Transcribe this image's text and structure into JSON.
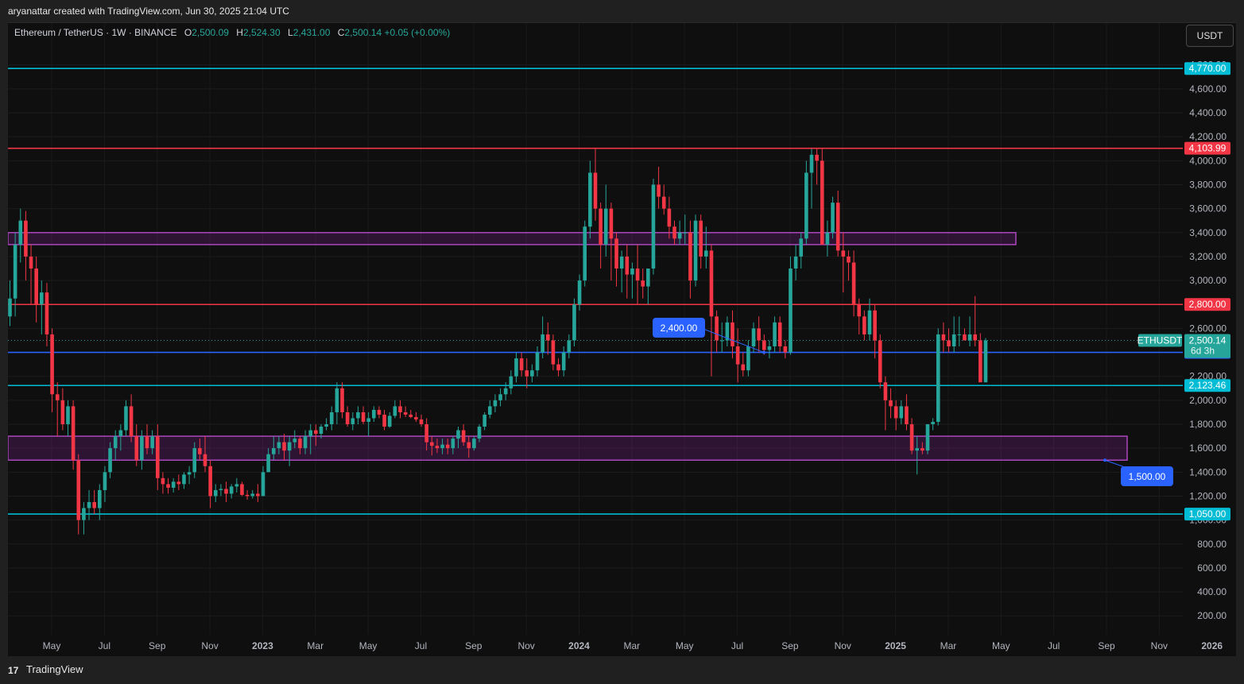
{
  "header": {
    "attribution": "aryanattar created with TradingView.com, Jun 30, 2025 21:04 UTC"
  },
  "legend": {
    "symbol": "Ethereum / TetherUS · 1W · BINANCE",
    "o_label": "O",
    "o_value": "2,500.09",
    "h_label": "H",
    "h_value": "2,524.30",
    "l_label": "L",
    "l_value": "2,431.00",
    "c_label": "C",
    "c_value": "2,500.14",
    "change": "+0.05 (+0.00%)"
  },
  "currency_button": "USDT",
  "footer": {
    "brand": "TradingView",
    "logo": "17"
  },
  "colors": {
    "up": "#26a69a",
    "down": "#f23645",
    "cyan": "#00bcd4",
    "red_line": "#f23645",
    "blue_line": "#2962ff",
    "zone": "#9c27b0",
    "background": "#0f0f0f"
  },
  "chart_data": {
    "type": "candlestick",
    "symbol": "ETHUSDT",
    "interval": "1W",
    "ylim": [
      100,
      4900
    ],
    "y_ticks": [
      "200.00",
      "400.00",
      "600.00",
      "800.00",
      "1,000.00",
      "1,200.00",
      "1,400.00",
      "1,600.00",
      "1,800.00",
      "2,000.00",
      "2,200.00",
      "2,400.00",
      "2,600.00",
      "2,800.00",
      "3,000.00",
      "3,200.00",
      "3,400.00",
      "3,600.00",
      "3,800.00",
      "4,000.00",
      "4,200.00",
      "4,400.00",
      "4,600.00",
      "4,800.00"
    ],
    "x_ticks": [
      "May",
      "Jul",
      "Sep",
      "Nov",
      "2023",
      "Mar",
      "May",
      "Jul",
      "Sep",
      "Nov",
      "2024",
      "Mar",
      "May",
      "Jul",
      "Sep",
      "Nov",
      "2025",
      "Mar",
      "May",
      "Jul",
      "Sep",
      "Nov",
      "2026"
    ],
    "candles": [
      [
        2700,
        3000,
        2620,
        2850
      ],
      [
        2850,
        3400,
        2700,
        3300
      ],
      [
        3300,
        3600,
        3150,
        3500
      ],
      [
        3500,
        3580,
        3000,
        3200
      ],
      [
        3200,
        3300,
        2800,
        3100
      ],
      [
        3100,
        3200,
        2650,
        2800
      ],
      [
        2800,
        3000,
        2550,
        2900
      ],
      [
        2900,
        2980,
        2450,
        2550
      ],
      [
        2550,
        2600,
        1900,
        2050
      ],
      [
        2050,
        2150,
        1700,
        2000
      ],
      [
        2000,
        2100,
        1750,
        1800
      ],
      [
        1800,
        2000,
        1700,
        1950
      ],
      [
        1950,
        2000,
        1420,
        1500
      ],
      [
        1500,
        1550,
        880,
        1000
      ],
      [
        1000,
        1150,
        880,
        1100
      ],
      [
        1100,
        1250,
        1000,
        1150
      ],
      [
        1150,
        1250,
        1050,
        1100
      ],
      [
        1100,
        1300,
        1000,
        1250
      ],
      [
        1250,
        1450,
        1150,
        1400
      ],
      [
        1400,
        1650,
        1350,
        1600
      ],
      [
        1600,
        1750,
        1500,
        1700
      ],
      [
        1700,
        1800,
        1580,
        1750
      ],
      [
        1750,
        2000,
        1700,
        1950
      ],
      [
        1950,
        2050,
        1650,
        1700
      ],
      [
        1700,
        1800,
        1450,
        1500
      ],
      [
        1500,
        1750,
        1420,
        1700
      ],
      [
        1700,
        1800,
        1550,
        1600
      ],
      [
        1600,
        1750,
        1550,
        1700
      ],
      [
        1700,
        1800,
        1250,
        1350
      ],
      [
        1350,
        1400,
        1220,
        1300
      ],
      [
        1300,
        1350,
        1220,
        1270
      ],
      [
        1270,
        1350,
        1230,
        1320
      ],
      [
        1320,
        1380,
        1250,
        1300
      ],
      [
        1300,
        1400,
        1260,
        1380
      ],
      [
        1380,
        1450,
        1300,
        1400
      ],
      [
        1400,
        1650,
        1350,
        1600
      ],
      [
        1600,
        1680,
        1500,
        1550
      ],
      [
        1550,
        1700,
        1400,
        1450
      ],
      [
        1450,
        1500,
        1100,
        1200
      ],
      [
        1200,
        1300,
        1150,
        1250
      ],
      [
        1250,
        1300,
        1200,
        1260
      ],
      [
        1260,
        1320,
        1150,
        1220
      ],
      [
        1220,
        1300,
        1180,
        1280
      ],
      [
        1280,
        1350,
        1230,
        1300
      ],
      [
        1300,
        1320,
        1200,
        1210
      ],
      [
        1210,
        1250,
        1170,
        1200
      ],
      [
        1200,
        1250,
        1180,
        1220
      ],
      [
        1220,
        1300,
        1150,
        1200
      ],
      [
        1200,
        1450,
        1200,
        1400
      ],
      [
        1400,
        1600,
        1400,
        1550
      ],
      [
        1550,
        1700,
        1500,
        1600
      ],
      [
        1600,
        1700,
        1550,
        1650
      ],
      [
        1650,
        1720,
        1500,
        1580
      ],
      [
        1580,
        1700,
        1450,
        1650
      ],
      [
        1650,
        1750,
        1600,
        1680
      ],
      [
        1680,
        1700,
        1550,
        1600
      ],
      [
        1600,
        1750,
        1550,
        1700
      ],
      [
        1700,
        1800,
        1550,
        1750
      ],
      [
        1750,
        1800,
        1620,
        1720
      ],
      [
        1720,
        1800,
        1680,
        1780
      ],
      [
        1780,
        1850,
        1750,
        1800
      ],
      [
        1800,
        1950,
        1750,
        1900
      ],
      [
        1900,
        2150,
        1800,
        2100
      ],
      [
        2100,
        2150,
        1850,
        1900
      ],
      [
        1900,
        1950,
        1780,
        1800
      ],
      [
        1800,
        1900,
        1750,
        1850
      ],
      [
        1850,
        1950,
        1800,
        1900
      ],
      [
        1900,
        1950,
        1800,
        1820
      ],
      [
        1820,
        1900,
        1700,
        1850
      ],
      [
        1850,
        1950,
        1820,
        1920
      ],
      [
        1920,
        1950,
        1850,
        1880
      ],
      [
        1880,
        1920,
        1750,
        1780
      ],
      [
        1780,
        1900,
        1770,
        1870
      ],
      [
        1870,
        2000,
        1850,
        1950
      ],
      [
        1950,
        2000,
        1850,
        1900
      ],
      [
        1900,
        1950,
        1860,
        1880
      ],
      [
        1880,
        1920,
        1850,
        1860
      ],
      [
        1860,
        1900,
        1820,
        1840
      ],
      [
        1840,
        1880,
        1780,
        1800
      ],
      [
        1800,
        1850,
        1580,
        1650
      ],
      [
        1650,
        1700,
        1540,
        1620
      ],
      [
        1620,
        1680,
        1560,
        1600
      ],
      [
        1600,
        1680,
        1550,
        1630
      ],
      [
        1630,
        1680,
        1550,
        1600
      ],
      [
        1600,
        1700,
        1550,
        1680
      ],
      [
        1680,
        1780,
        1600,
        1750
      ],
      [
        1750,
        1800,
        1620,
        1650
      ],
      [
        1650,
        1700,
        1520,
        1600
      ],
      [
        1600,
        1700,
        1580,
        1680
      ],
      [
        1680,
        1800,
        1650,
        1780
      ],
      [
        1780,
        1900,
        1750,
        1880
      ],
      [
        1880,
        2000,
        1850,
        1950
      ],
      [
        1950,
        2050,
        1900,
        2000
      ],
      [
        2000,
        2100,
        1950,
        2050
      ],
      [
        2050,
        2150,
        2000,
        2100
      ],
      [
        2100,
        2250,
        2050,
        2200
      ],
      [
        2200,
        2400,
        2150,
        2350
      ],
      [
        2350,
        2400,
        2200,
        2250
      ],
      [
        2250,
        2350,
        2100,
        2200
      ],
      [
        2200,
        2300,
        2150,
        2250
      ],
      [
        2250,
        2450,
        2200,
        2400
      ],
      [
        2400,
        2700,
        2350,
        2550
      ],
      [
        2550,
        2650,
        2380,
        2500
      ],
      [
        2500,
        2550,
        2250,
        2300
      ],
      [
        2300,
        2350,
        2200,
        2250
      ],
      [
        2250,
        2450,
        2200,
        2400
      ],
      [
        2400,
        2550,
        2350,
        2500
      ],
      [
        2500,
        2850,
        2450,
        2800
      ],
      [
        2800,
        3050,
        2750,
        3000
      ],
      [
        3000,
        3500,
        2950,
        3450
      ],
      [
        3450,
        4000,
        3350,
        3900
      ],
      [
        3900,
        4100,
        3500,
        3600
      ],
      [
        3600,
        3650,
        3100,
        3300
      ],
      [
        3300,
        3800,
        3200,
        3600
      ],
      [
        3600,
        3650,
        3000,
        3350
      ],
      [
        3350,
        3400,
        2950,
        3100
      ],
      [
        3100,
        3250,
        2900,
        3200
      ],
      [
        3200,
        3300,
        2850,
        3050
      ],
      [
        3050,
        3150,
        2850,
        3100
      ],
      [
        3100,
        3300,
        2800,
        3000
      ],
      [
        3000,
        3100,
        2850,
        2950
      ],
      [
        2950,
        3100,
        2800,
        3100
      ],
      [
        3100,
        3850,
        3050,
        3800
      ],
      [
        3800,
        3950,
        3600,
        3700
      ],
      [
        3700,
        3800,
        3550,
        3600
      ],
      [
        3600,
        3700,
        3350,
        3450
      ],
      [
        3450,
        3500,
        3300,
        3350
      ],
      [
        3350,
        3500,
        3300,
        3400
      ],
      [
        3400,
        3550,
        3300,
        3400
      ],
      [
        3400,
        3500,
        2850,
        3000
      ],
      [
        3000,
        3550,
        2950,
        3500
      ],
      [
        3500,
        3550,
        3100,
        3200
      ],
      [
        3200,
        3450,
        3100,
        3250
      ],
      [
        3250,
        3300,
        2200,
        2700
      ],
      [
        2700,
        2750,
        2400,
        2500
      ],
      [
        2500,
        2650,
        2400,
        2500
      ],
      [
        2500,
        2700,
        2450,
        2650
      ],
      [
        2650,
        2750,
        2350,
        2450
      ],
      [
        2450,
        2600,
        2150,
        2300
      ],
      [
        2300,
        2400,
        2200,
        2250
      ],
      [
        2250,
        2500,
        2200,
        2450
      ],
      [
        2450,
        2650,
        2400,
        2600
      ],
      [
        2600,
        2700,
        2400,
        2500
      ],
      [
        2500,
        2550,
        2380,
        2420
      ],
      [
        2420,
        2500,
        2350,
        2450
      ],
      [
        2450,
        2700,
        2400,
        2650
      ],
      [
        2650,
        2700,
        2400,
        2450
      ],
      [
        2450,
        2500,
        2350,
        2400
      ],
      [
        2400,
        3200,
        2380,
        3100
      ],
      [
        3100,
        3300,
        3000,
        3200
      ],
      [
        3200,
        3400,
        3100,
        3350
      ],
      [
        3350,
        4000,
        3300,
        3900
      ],
      [
        3900,
        4100,
        3600,
        4050
      ],
      [
        4050,
        4100,
        3800,
        4000
      ],
      [
        4000,
        4100,
        3300,
        3300
      ],
      [
        3300,
        3500,
        3200,
        3400
      ],
      [
        3400,
        3700,
        3350,
        3650
      ],
      [
        3650,
        3750,
        3200,
        3250
      ],
      [
        3250,
        3400,
        2900,
        3200
      ],
      [
        3200,
        3250,
        3000,
        3150
      ],
      [
        3150,
        3250,
        2700,
        2800
      ],
      [
        2800,
        2850,
        2550,
        2700
      ],
      [
        2700,
        2750,
        2500,
        2550
      ],
      [
        2550,
        2850,
        2500,
        2750
      ],
      [
        2750,
        2800,
        2350,
        2500
      ],
      [
        2500,
        2550,
        2100,
        2150
      ],
      [
        2150,
        2200,
        1750,
        2000
      ],
      [
        2000,
        2100,
        1850,
        1950
      ],
      [
        1950,
        2000,
        1750,
        1850
      ],
      [
        1850,
        2000,
        1800,
        1950
      ],
      [
        1950,
        2050,
        1750,
        1800
      ],
      [
        1800,
        1850,
        1550,
        1580
      ],
      [
        1580,
        1700,
        1380,
        1600
      ],
      [
        1600,
        1650,
        1550,
        1580
      ],
      [
        1580,
        1800,
        1550,
        1800
      ],
      [
        1800,
        1850,
        1750,
        1820
      ],
      [
        1820,
        2600,
        1790,
        2550
      ],
      [
        2550,
        2650,
        2400,
        2500
      ],
      [
        2500,
        2600,
        2400,
        2450
      ],
      [
        2450,
        2700,
        2400,
        2550
      ],
      [
        2550,
        2700,
        2450,
        2550
      ],
      [
        2550,
        2600,
        2500,
        2500
      ],
      [
        2500,
        2700,
        2450,
        2550
      ],
      [
        2550,
        2870,
        2450,
        2500
      ],
      [
        2500,
        2560,
        2200,
        2150
      ],
      [
        2150,
        2520,
        2150,
        2500
      ]
    ],
    "levels": [
      {
        "price": 4770,
        "color": "cyan",
        "label": "4,770.00"
      },
      {
        "price": 4103.99,
        "color": "red",
        "label": "4,103.99"
      },
      {
        "price": 2800,
        "color": "red",
        "label": "2,800.00"
      },
      {
        "price": 2400,
        "color": "blue",
        "label": "2,400.00"
      },
      {
        "price": 2123.46,
        "color": "cyan",
        "label": "2,123.46"
      },
      {
        "price": 1050,
        "color": "cyan",
        "label": "1,050.00"
      }
    ],
    "zones": [
      {
        "from": 3300,
        "to": 3400
      },
      {
        "from": 1500,
        "to": 1700
      }
    ],
    "callouts": [
      {
        "label": "2,400.00",
        "price": 2400
      },
      {
        "label": "1,500.00",
        "price": 1500
      }
    ],
    "current": {
      "symbol": "ETHUSDT",
      "price": 2500.14,
      "price_label": "2,500.14",
      "countdown": "6d 3h"
    }
  }
}
